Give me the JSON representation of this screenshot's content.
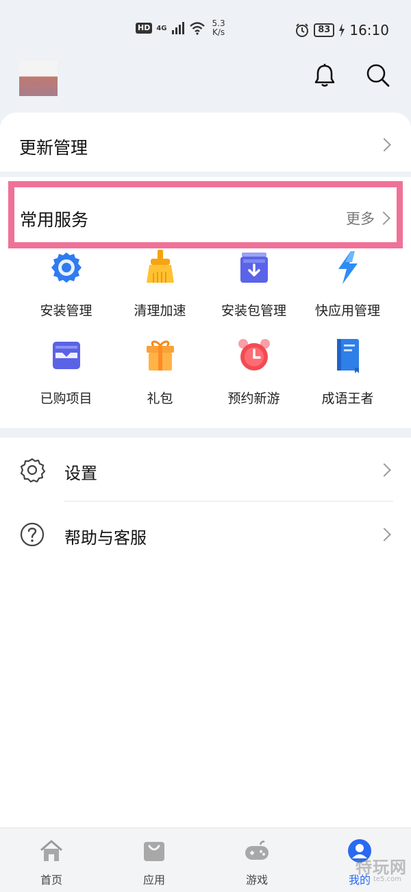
{
  "status_bar": {
    "hd": "HD",
    "network": "4G",
    "speed_value": "5.3",
    "speed_unit": "K/s",
    "battery": "83",
    "time": "16:10"
  },
  "header": {
    "notification_icon": "bell-icon",
    "search_icon": "search-icon"
  },
  "update_section": {
    "label": "更新管理"
  },
  "services": {
    "title": "常用服务",
    "more": "更多",
    "items": [
      {
        "label": "安装管理",
        "icon": "gear-install-icon"
      },
      {
        "label": "清理加速",
        "icon": "broom-icon"
      },
      {
        "label": "安装包管理",
        "icon": "package-icon"
      },
      {
        "label": "快应用管理",
        "icon": "lightning-icon"
      },
      {
        "label": "已购项目",
        "icon": "purchased-icon"
      },
      {
        "label": "礼包",
        "icon": "gift-icon"
      },
      {
        "label": "预约新游",
        "icon": "alarm-clock-icon"
      },
      {
        "label": "成语王者",
        "icon": "book-icon"
      }
    ]
  },
  "settings_list": [
    {
      "label": "设置",
      "icon": "settings-icon"
    },
    {
      "label": "帮助与客服",
      "icon": "help-icon"
    }
  ],
  "bottom_nav": {
    "items": [
      {
        "label": "首页",
        "icon": "home-icon",
        "active": false
      },
      {
        "label": "应用",
        "icon": "apps-bag-icon",
        "active": false
      },
      {
        "label": "游戏",
        "icon": "gamepad-icon",
        "active": false
      },
      {
        "label": "我的",
        "icon": "profile-icon",
        "active": true
      }
    ]
  },
  "watermark": {
    "text": "特玩网",
    "sub": "te5.com"
  },
  "colors": {
    "highlight": "#f07197",
    "accent": "#2a6af0",
    "background": "#eef1f5"
  }
}
